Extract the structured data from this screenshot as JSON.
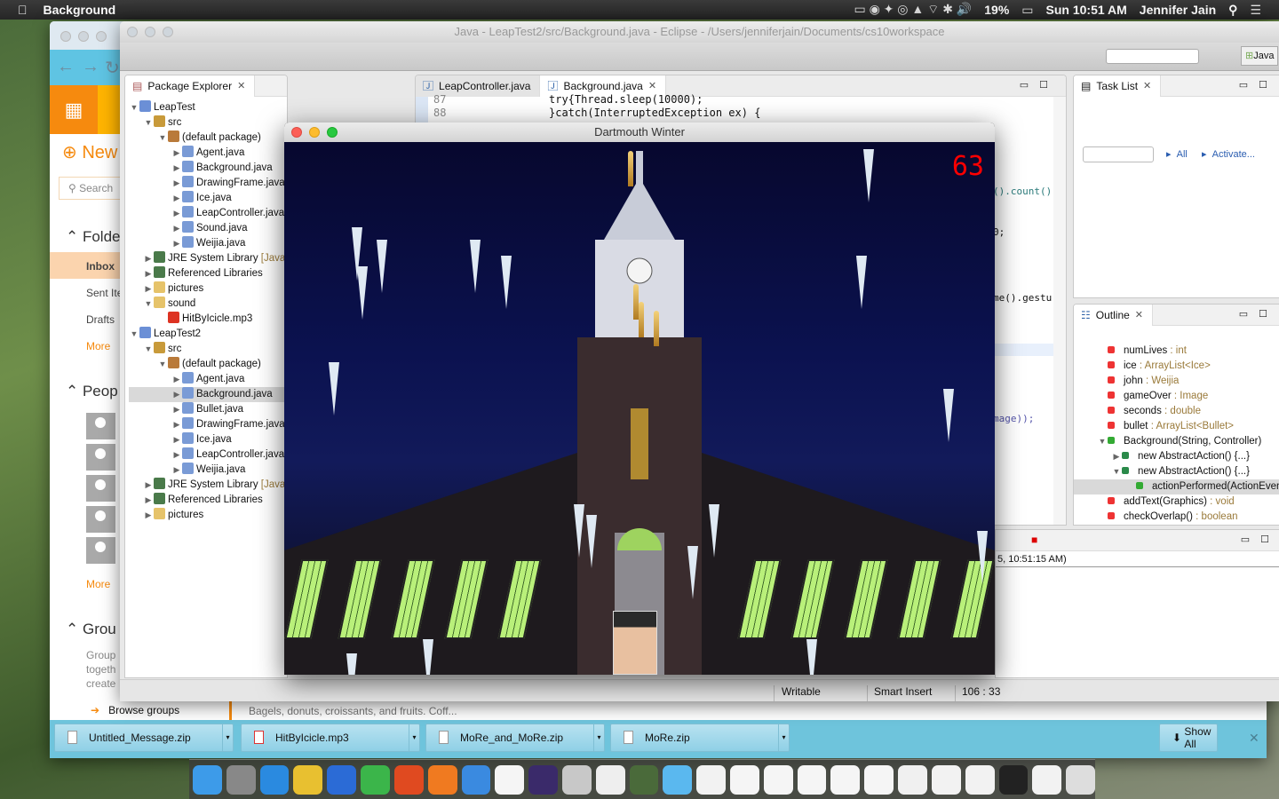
{
  "menubar": {
    "app_name": "Background",
    "clock": "Sun 10:51 AM",
    "user": "Jennifer Jain",
    "battery": "19%"
  },
  "browser": {
    "new_label": "New",
    "search_placeholder": "Search",
    "folders_header": "Folde",
    "folders": [
      "Inbox",
      "Sent Ite",
      "Drafts"
    ],
    "folders_more": "More",
    "people_header": "Peop",
    "people_more": "More",
    "groups_header": "Grou",
    "groups_text": [
      "Group",
      "togeth",
      "create"
    ],
    "browse_groups": "Browse groups",
    "message_preview": "Bagels, donuts, croissants, and fruits. Coff...",
    "downloads": [
      {
        "name": "Untitled_Message.zip"
      },
      {
        "name": "HitByIcicle.mp3"
      },
      {
        "name": "MoRe_and_MoRe.zip"
      },
      {
        "name": "MoRe.zip"
      }
    ],
    "show_all": "Show All"
  },
  "eclipse": {
    "title": "Java - LeapTest2/src/Background.java - Eclipse - /Users/jenniferjain/Documents/cs10workspace",
    "perspective": "Java",
    "package_explorer": {
      "title": "Package Explorer",
      "tree": [
        {
          "l": 0,
          "t": "LeapTest",
          "o": "v",
          "i": "project"
        },
        {
          "l": 1,
          "t": "src",
          "o": "v",
          "i": "src"
        },
        {
          "l": 2,
          "t": "(default package)",
          "o": "v",
          "i": "pkg"
        },
        {
          "l": 3,
          "t": "Agent.java",
          "o": ">",
          "i": "java"
        },
        {
          "l": 3,
          "t": "Background.java",
          "o": ">",
          "i": "java"
        },
        {
          "l": 3,
          "t": "DrawingFrame.java",
          "o": ">",
          "i": "java"
        },
        {
          "l": 3,
          "t": "Ice.java",
          "o": ">",
          "i": "java"
        },
        {
          "l": 3,
          "t": "LeapController.java",
          "o": ">",
          "i": "java"
        },
        {
          "l": 3,
          "t": "Sound.java",
          "o": ">",
          "i": "java"
        },
        {
          "l": 3,
          "t": "Weijia.java",
          "o": ">",
          "i": "java"
        },
        {
          "l": 1,
          "t": "JRE System Library",
          "d": "[JavaSE]",
          "o": ">",
          "i": "lib"
        },
        {
          "l": 1,
          "t": "Referenced Libraries",
          "o": ">",
          "i": "lib"
        },
        {
          "l": 1,
          "t": "pictures",
          "o": ">",
          "i": "folder"
        },
        {
          "l": 1,
          "t": "sound",
          "o": "v",
          "i": "folder"
        },
        {
          "l": 2,
          "t": "HitByIcicle.mp3",
          "o": "",
          "i": "mp3"
        },
        {
          "l": 0,
          "t": "LeapTest2",
          "o": "v",
          "i": "project"
        },
        {
          "l": 1,
          "t": "src",
          "o": "v",
          "i": "src"
        },
        {
          "l": 2,
          "t": "(default package)",
          "o": "v",
          "i": "pkg"
        },
        {
          "l": 3,
          "t": "Agent.java",
          "o": ">",
          "i": "java"
        },
        {
          "l": 3,
          "t": "Background.java",
          "o": ">",
          "i": "java",
          "sel": true
        },
        {
          "l": 3,
          "t": "Bullet.java",
          "o": ">",
          "i": "java"
        },
        {
          "l": 3,
          "t": "DrawingFrame.java",
          "o": ">",
          "i": "java"
        },
        {
          "l": 3,
          "t": "Ice.java",
          "o": ">",
          "i": "java"
        },
        {
          "l": 3,
          "t": "LeapController.java",
          "o": ">",
          "i": "java"
        },
        {
          "l": 3,
          "t": "Weijia.java",
          "o": ">",
          "i": "java"
        },
        {
          "l": 1,
          "t": "JRE System Library",
          "d": "[JavaSE]",
          "o": ">",
          "i": "lib"
        },
        {
          "l": 1,
          "t": "Referenced Libraries",
          "o": ">",
          "i": "lib"
        },
        {
          "l": 1,
          "t": "pictures",
          "o": ">",
          "i": "folder"
        }
      ]
    },
    "editor": {
      "tabs": [
        {
          "label": "LeapController.java"
        },
        {
          "label": "Background.java",
          "active": true
        }
      ],
      "lines": [
        {
          "n": "87",
          "code": "try{Thread.sleep(10000);"
        },
        {
          "n": "88",
          "code": "}catch(InterruptedException ex) {"
        }
      ],
      "fragments": [
        "().count()",
        "0;",
        "me().gestu",
        "mage));"
      ]
    },
    "task_list": {
      "title": "Task List",
      "filter_all": "All",
      "activate": "Activate..."
    },
    "outline": {
      "title": "Outline",
      "items": [
        {
          "l": 0,
          "t": "numLives",
          "d": " : int",
          "i": "field"
        },
        {
          "l": 0,
          "t": "ice",
          "d": " : ArrayList<Ice>",
          "i": "field"
        },
        {
          "l": 0,
          "t": "john",
          "d": " : Weijia",
          "i": "field"
        },
        {
          "l": 0,
          "t": "gameOver",
          "d": " : Image",
          "i": "field"
        },
        {
          "l": 0,
          "t": "seconds",
          "d": " : double",
          "i": "field"
        },
        {
          "l": 0,
          "t": "bullet",
          "d": " : ArrayList<Bullet>",
          "i": "field"
        },
        {
          "l": 0,
          "t": "Background(String, Controller)",
          "d": "",
          "i": "ctor",
          "o": "v"
        },
        {
          "l": 1,
          "t": "new AbstractAction() {...}",
          "d": "",
          "i": "anon",
          "o": ">"
        },
        {
          "l": 1,
          "t": "new AbstractAction() {...}",
          "d": "",
          "i": "anon",
          "o": "v"
        },
        {
          "l": 2,
          "t": "actionPerformed(ActionEvent)",
          "d": "",
          "i": "method",
          "sel": true
        },
        {
          "l": 0,
          "t": "addText(Graphics)",
          "d": " : void",
          "i": "pmethod"
        },
        {
          "l": 0,
          "t": "checkOverlap()",
          "d": " : boolean",
          "i": "pmethod"
        }
      ]
    },
    "console": {
      "text": "5, 10:51:15 AM)"
    },
    "status": {
      "writable": "Writable",
      "insert_mode": "Smart Insert",
      "position": "106 : 33"
    }
  },
  "game": {
    "title": "Dartmouth Winter",
    "score": "63"
  },
  "dock": [
    "finder",
    "launchpad",
    "safari",
    "chrome",
    "word",
    "evernote",
    "powerpoint",
    "firefox",
    "xcode",
    "calendar",
    "eclipse",
    "game-center",
    "java",
    "photo",
    "folder",
    "doc",
    "chrome-doc",
    "chrome-doc",
    "chrome-doc",
    "chrome-doc",
    "chrome-doc",
    "safari-doc",
    "doc",
    "doc",
    "terminal-doc",
    "doc",
    "trash"
  ],
  "colors": {
    "accent_orange": "#f68a0e",
    "downloads_bar": "#6ec4dc",
    "score_red": "#ff0000",
    "link_blue": "#2a5db0"
  }
}
